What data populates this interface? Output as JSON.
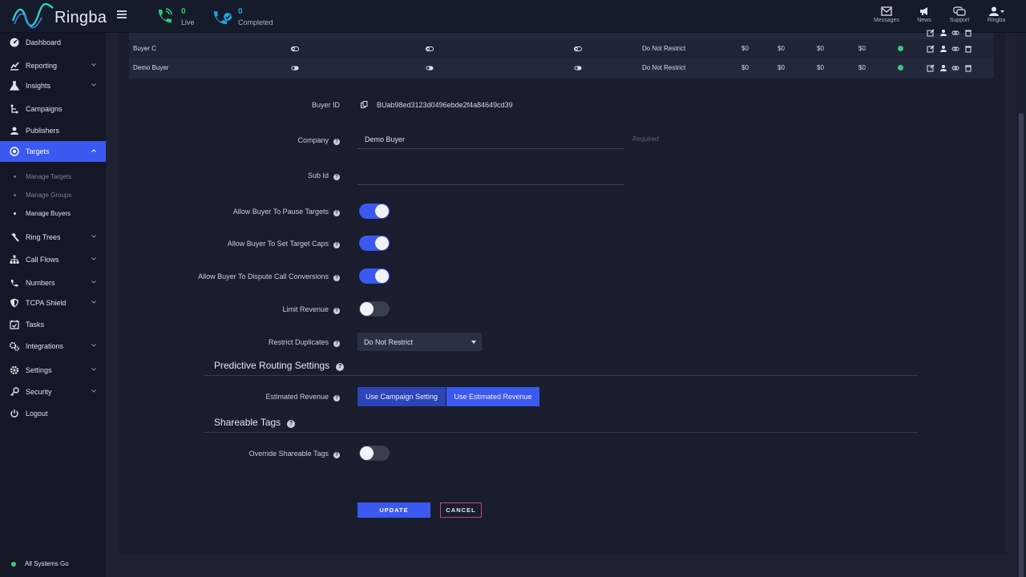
{
  "app": {
    "name": "Ringba"
  },
  "topbar": {
    "live": {
      "count": "0",
      "label": "Live"
    },
    "completed": {
      "count": "0",
      "label": "Completed"
    },
    "messages": "Messages",
    "news": "News",
    "support": "Support",
    "user": "Ringba"
  },
  "sidebar": {
    "items": [
      {
        "label": "Dashboard",
        "icon": "dashboard-icon"
      },
      {
        "label": "Reporting",
        "icon": "chart-icon"
      },
      {
        "label": "Insights",
        "icon": "flask-icon"
      },
      {
        "label": "Campaigns",
        "icon": "campaign-icon"
      },
      {
        "label": "Publishers",
        "icon": "users-icon"
      },
      {
        "label": "Targets",
        "icon": "target-icon"
      },
      {
        "label": "Ring Trees",
        "icon": "hammer-icon"
      },
      {
        "label": "Call Flows",
        "icon": "sitemap-icon"
      },
      {
        "label": "Numbers",
        "icon": "phone-icon"
      },
      {
        "label": "TCPA Shield",
        "icon": "shield-icon"
      },
      {
        "label": "Tasks",
        "icon": "calendar-check-icon"
      },
      {
        "label": "Integrations",
        "icon": "cogs-icon"
      },
      {
        "label": "Settings",
        "icon": "gear-icon"
      },
      {
        "label": "Security",
        "icon": "key-icon"
      },
      {
        "label": "Logout",
        "icon": "power-icon"
      }
    ],
    "targets_sub": [
      {
        "label": "Manage Targets"
      },
      {
        "label": "Manage Groups"
      },
      {
        "label": "Manage Buyers"
      }
    ],
    "status": "All Systems Go"
  },
  "buyers_table": {
    "rows": [
      {
        "name": "Buyer C",
        "restrict": "Do Not Restrict",
        "v1": "$0",
        "v2": "$0",
        "v3": "$0",
        "v4": "$0"
      },
      {
        "name": "Demo Buyer",
        "restrict": "Do Not Restrict",
        "v1": "$0",
        "v2": "$0",
        "v3": "$0",
        "v4": "$0"
      }
    ]
  },
  "form": {
    "buyer_id_label": "Buyer ID",
    "buyer_id": "BUab98ed3123d0496ebde2f4a84649cd39",
    "company_label": "Company",
    "company_value": "Demo Buyer",
    "required": "Required",
    "subid_label": "Sub Id",
    "subid_value": "",
    "pause_label": "Allow Buyer To Pause Targets",
    "pause_on": true,
    "caps_label": "Allow Buyer To Set Target Caps",
    "caps_on": true,
    "dispute_label": "Allow Buyer To Dispute Call Conversions",
    "dispute_on": true,
    "limit_label": "Limit Revenue",
    "limit_on": false,
    "duplicates_label": "Restrict Duplicates",
    "duplicates_value": "Do Not Restrict",
    "predictive_title": "Predictive Routing Settings",
    "est_revenue_label": "Estimated Revenue",
    "est_option_a": "Use Campaign Setting",
    "est_option_b": "Use Estimated Revenue",
    "est_selected": "Use Estimated Revenue",
    "shareable_title": "Shareable Tags",
    "override_label": "Override Shareable Tags",
    "override_on": false,
    "update": "UPDATE",
    "cancel": "CANCEL"
  },
  "colors": {
    "accent": "#3b59f0",
    "live": "#2ecc71",
    "completed": "#1fa3e0",
    "ok": "#43c47a",
    "cancel_border": "#c8486a"
  }
}
